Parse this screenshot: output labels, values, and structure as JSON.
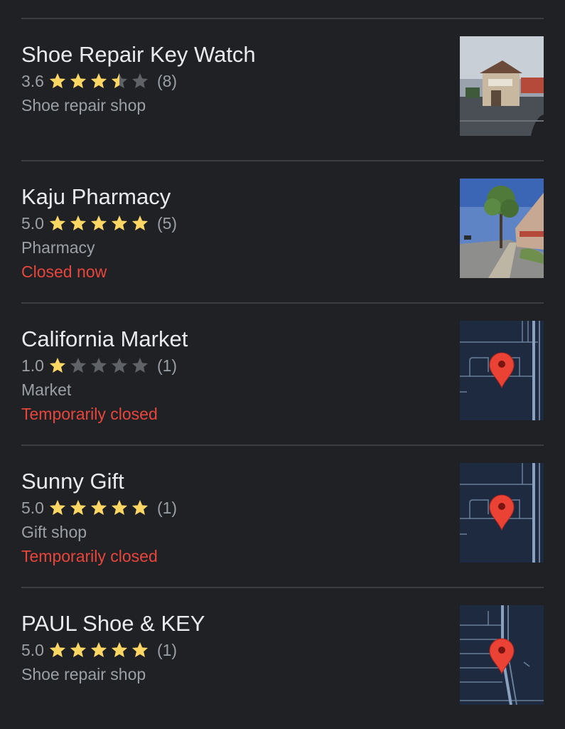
{
  "colors": {
    "background": "#202124",
    "star_filled": "#fdd663",
    "star_empty": "#5f6368",
    "status_red": "#e8453c",
    "map_bg": "#1e2a3f",
    "pin_red": "#ea4335"
  },
  "places": [
    {
      "name": "Shoe Repair Key Watch",
      "rating": "3.6",
      "rating_stars": 3.5,
      "review_count": "(8)",
      "category": "Shoe repair shop",
      "status": "",
      "thumbnail": "storefront-photo"
    },
    {
      "name": "Kaju Pharmacy",
      "rating": "5.0",
      "rating_stars": 5,
      "review_count": "(5)",
      "category": "Pharmacy",
      "status": "Closed now",
      "thumbnail": "street-photo"
    },
    {
      "name": "California Market",
      "rating": "1.0",
      "rating_stars": 1,
      "review_count": "(1)",
      "category": "Market",
      "status": "Temporarily closed",
      "thumbnail": "map-pin"
    },
    {
      "name": "Sunny Gift",
      "rating": "5.0",
      "rating_stars": 5,
      "review_count": "(1)",
      "category": "Gift shop",
      "status": "Temporarily closed",
      "thumbnail": "map-pin"
    },
    {
      "name": "PAUL Shoe & KEY",
      "rating": "5.0",
      "rating_stars": 5,
      "review_count": "(1)",
      "category": "Shoe repair shop",
      "status": "",
      "thumbnail": "map-pin"
    }
  ]
}
